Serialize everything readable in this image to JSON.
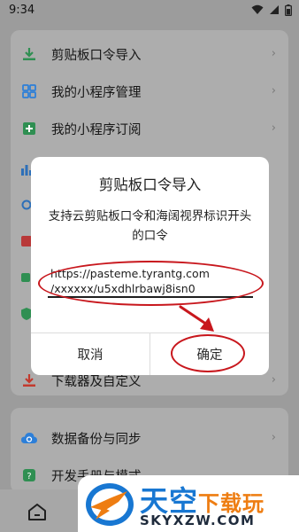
{
  "status_bar": {
    "time": "9:34"
  },
  "menu": {
    "items_top": [
      {
        "label": "剪贴板口令导入",
        "icon": "download-icon"
      },
      {
        "label": "我的小程序管理",
        "icon": "apps-grid-icon"
      },
      {
        "label": "我的小程序订阅",
        "icon": "subscribe-icon"
      }
    ],
    "item_bottom_partial": {
      "label": "下载器及自定义",
      "icon": "downloader-icon"
    },
    "items_second": [
      {
        "label": "数据备份与同步",
        "icon": "cloud-sync-icon"
      },
      {
        "label": "开发手册与模式",
        "icon": "help-icon"
      }
    ]
  },
  "dialog": {
    "title": "剪贴板口令导入",
    "message": "支持云剪贴板口令和海阔视界标识开头的口令",
    "input_line1": "https://pasteme.tyrantg.com",
    "input_line2": "/xxxxxx/u5xdhlrbawj8isn0",
    "cancel_label": "取消",
    "confirm_label": "确定"
  },
  "watermark": {
    "cn_blue": "天空",
    "cn_orange": "下载玩",
    "en": "SKYXZW.COM"
  },
  "colors": {
    "annotation_red": "#c8171d",
    "brand_blue": "#1877d2",
    "brand_orange": "#ee7d12",
    "icon_green": "#2f8f52",
    "icon_blue": "#2d7fd8"
  }
}
